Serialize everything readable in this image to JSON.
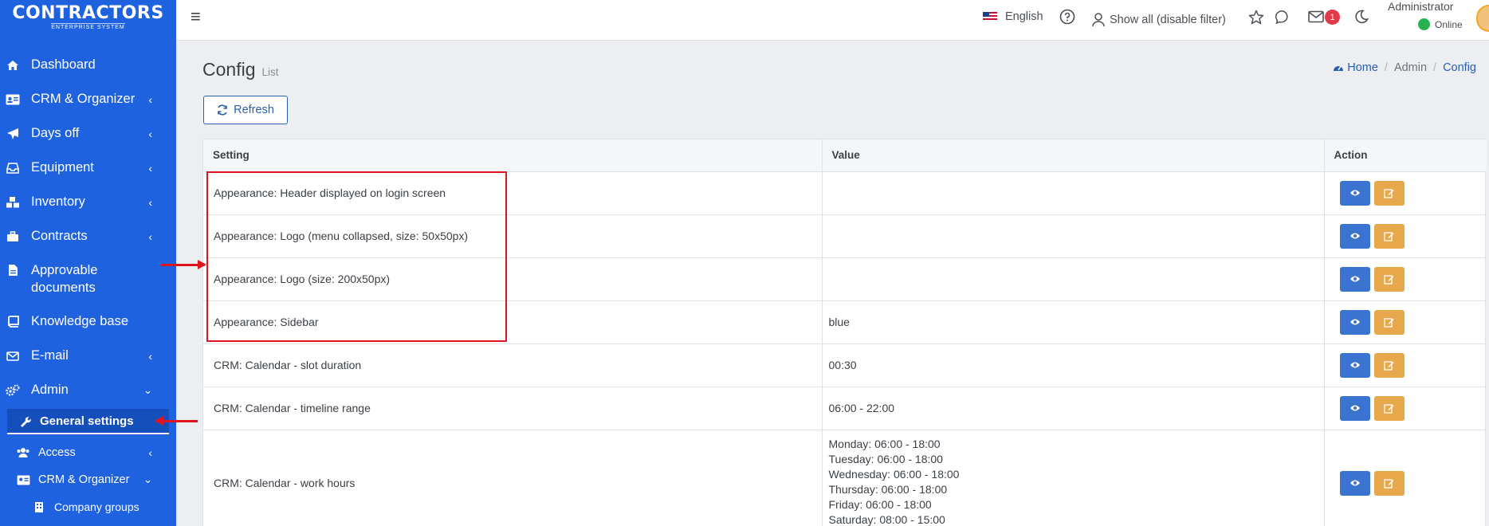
{
  "brand": {
    "logo_main": "CONTRACTORS",
    "logo_sub": "ENTERPRISE SYSTEM",
    "sidebar_color": "#1f62e0"
  },
  "sidebar": {
    "items": [
      {
        "label": "Dashboard",
        "icon": "home-icon"
      },
      {
        "label": "CRM & Organizer",
        "icon": "id-card-icon"
      },
      {
        "label": "Days off",
        "icon": "plane-icon"
      },
      {
        "label": "Equipment",
        "icon": "inbox-icon"
      },
      {
        "label": "Inventory",
        "icon": "cubes-icon"
      },
      {
        "label": "Contracts",
        "icon": "briefcase-icon"
      },
      {
        "label": "Approvable documents",
        "icon": "file-icon"
      },
      {
        "label": "Knowledge base",
        "icon": "book-icon"
      },
      {
        "label": "E-mail",
        "icon": "envelope-icon"
      },
      {
        "label": "Admin",
        "icon": "cogs-icon"
      }
    ],
    "sub": {
      "general_settings": "General settings",
      "access": "Access",
      "crm": "CRM & Organizer",
      "company_groups": "Company groups"
    }
  },
  "topbar": {
    "language": "English",
    "filter": "Show all (disable filter)",
    "mail_count": "1",
    "user_name": "Administrator",
    "status": "Online"
  },
  "page": {
    "title": "Config",
    "subtitle": "List",
    "refresh_label": "Refresh",
    "breadcrumb": [
      "Home",
      "Admin",
      "Config"
    ]
  },
  "table": {
    "headers": [
      "Setting",
      "Value",
      "Action"
    ],
    "rows": [
      {
        "setting": "Appearance: Header displayed on login screen",
        "value": ""
      },
      {
        "setting": "Appearance: Logo (menu collapsed, size: 50x50px)",
        "value": ""
      },
      {
        "setting": "Appearance: Logo (size: 200x50px)",
        "value": ""
      },
      {
        "setting": "Appearance: Sidebar",
        "value": "blue"
      },
      {
        "setting": "CRM: Calendar - slot duration",
        "value": "00:30"
      },
      {
        "setting": "CRM: Calendar - timeline range",
        "value": "06:00 - 22:00"
      },
      {
        "setting": "CRM: Calendar - work hours",
        "value_lines": [
          "Monday: 06:00 - 18:00",
          "Tuesday: 06:00 - 18:00",
          "Wednesday: 06:00 - 18:00",
          "Thursday: 06:00 - 18:00",
          "Friday: 06:00 - 18:00",
          "Saturday: 08:00 - 15:00"
        ]
      }
    ]
  }
}
